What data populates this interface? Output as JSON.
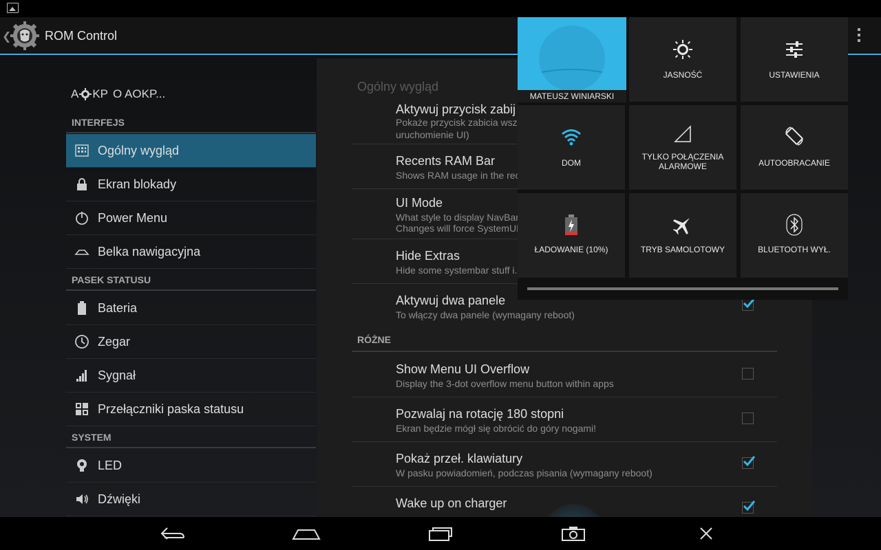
{
  "status_bar": {
    "notification_icon": "image-icon"
  },
  "action_bar": {
    "title": "ROM Control",
    "icon": "aokp-lion-icon",
    "overflow_icon": "overflow-menu-icon"
  },
  "sidebar": {
    "header_prefix": "A",
    "header_mid": "KP",
    "header_suffix": "O AOKP...",
    "sections": [
      {
        "label": "INTERFEJS"
      },
      {
        "label": "PASEK STATUSU"
      },
      {
        "label": "SYSTEM"
      }
    ],
    "items": [
      {
        "label": "Ogólny wygląd",
        "icon": "grid-icon",
        "active": true
      },
      {
        "label": "Ekran blokady",
        "icon": "lock-icon"
      },
      {
        "label": "Power Menu",
        "icon": "power-icon"
      },
      {
        "label": "Belka nawigacyjna",
        "icon": "navbar-icon"
      },
      {
        "label": "Bateria",
        "icon": "battery-icon"
      },
      {
        "label": "Zegar",
        "icon": "clock-icon"
      },
      {
        "label": "Sygnał",
        "icon": "signal-icon"
      },
      {
        "label": "Przełączniki paska statusu",
        "icon": "toggles-icon"
      },
      {
        "label": "LED",
        "icon": "bulb-icon"
      },
      {
        "label": "Dźwięki",
        "icon": "speaker-icon"
      }
    ]
  },
  "settings": {
    "title": "Ogólny wygląd",
    "prefs": [
      {
        "title": "Aktywuj przycisk zabij",
        "summary": "Pokaże przycisk zabicia wsz",
        "summary2": "uruchomienie UI)"
      },
      {
        "title": "Recents RAM Bar",
        "summary": "Shows RAM usage in the rec"
      },
      {
        "title": "UI Mode",
        "summary": "What style to display NavBar",
        "summary2": "Changes will force SystemUI"
      },
      {
        "title": "Hide Extras",
        "summary": "Hide some systembar stuff i.e"
      },
      {
        "title": "Aktywuj dwa panele",
        "summary": "To włączy dwa panele (wymagany reboot)",
        "checked": true
      }
    ],
    "group_label": "RÓŻNE",
    "prefs2": [
      {
        "title": "Show Menu UI Overflow",
        "summary": "Display the 3-dot overflow menu button within apps",
        "checked": false
      },
      {
        "title": "Pozwalaj na rotację 180 stopni",
        "summary": "Ekran będzie mógł się obrócić do góry nogami!",
        "checked": false
      },
      {
        "title": "Pokaż przeł. klawiatury",
        "summary": "W pasku powiadomień, podczas pisania (wymagany reboot)",
        "checked": true
      },
      {
        "title": "Wake up on charger",
        "summary": "",
        "checked": true
      }
    ]
  },
  "quick_settings": {
    "user": "MATEUSZ WINIARSKI",
    "tiles": [
      {
        "label": "JASNOŚĆ",
        "icon": "brightness-icon"
      },
      {
        "label": "USTAWIENIA",
        "icon": "settings-sliders-icon"
      },
      {
        "label": "DOM",
        "icon": "wifi-icon"
      },
      {
        "label": "TYLKO POŁĄCZENIA",
        "label2": "ALARMOWE",
        "icon": "signal-empty-icon"
      },
      {
        "label": "AUTOOBRACANIE",
        "icon": "rotate-icon"
      },
      {
        "label": "ŁADOWANIE (10%)",
        "icon": "battery-charging-icon"
      },
      {
        "label": "TRYB SAMOLOTOWY",
        "icon": "airplane-icon"
      },
      {
        "label": "BLUETOOTH WYŁ.",
        "icon": "bluetooth-icon"
      }
    ],
    "battery_level": 0.1
  },
  "nav_bar": {
    "buttons": [
      "back-icon",
      "home-icon",
      "recents-icon",
      "screenshot-icon",
      "close-icon"
    ]
  },
  "colors": {
    "accent": "#33b5e5",
    "active_item": "#1f5f7c",
    "battery_low": "#e53030"
  }
}
